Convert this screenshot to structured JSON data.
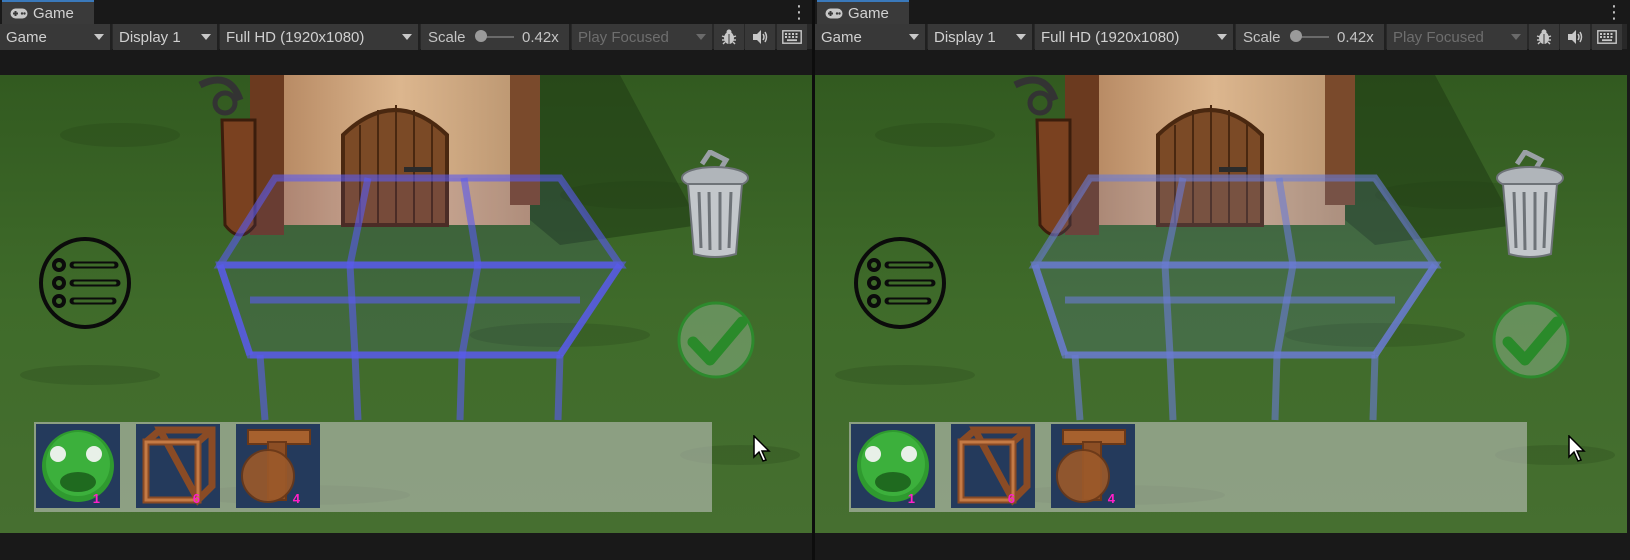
{
  "window": {
    "tab_label": "Game",
    "menu_glyph": "⋮"
  },
  "toolbar": {
    "view_mode": "Game",
    "display": "Display 1",
    "resolution": "Full HD (1920x1080)",
    "scale_label": "Scale",
    "scale_value": "0.42x",
    "play_mode": "Play Focused",
    "scale_level": 0.1
  },
  "icons": {
    "tab": "gamepad-icon",
    "kebab": "kebab-menu-icon",
    "bug": "bug-icon",
    "audio": "speaker-icon",
    "keyboard": "keyboard-icon",
    "menu": "list-menu-icon",
    "trash": "trash-can-icon",
    "confirm": "checkmark-icon",
    "cursor": "mouse-cursor-icon"
  },
  "inventory": [
    {
      "item": "green-slime",
      "count": "1"
    },
    {
      "item": "wooden-cube-frame",
      "count": "6"
    },
    {
      "item": "wooden-t-table",
      "count": "4"
    }
  ],
  "colors": {
    "grid_left": "#5a5af0",
    "grid_right": "#6b7bd6",
    "count_text": "#ff1fc8",
    "grass": "#3f6b2a",
    "accent_tab": "#3a79bb"
  }
}
